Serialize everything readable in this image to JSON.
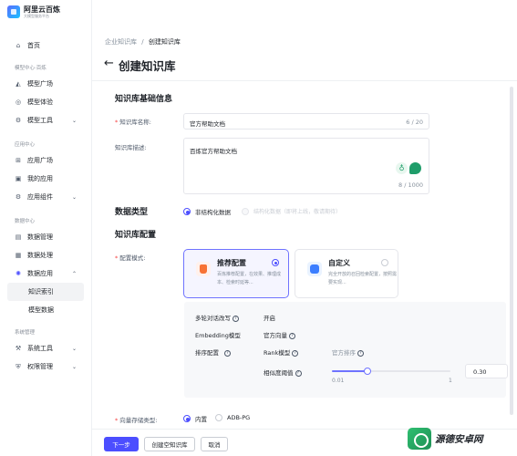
{
  "brand": {
    "title": "阿里云百炼",
    "subtitle": "大模型服务平台"
  },
  "sidebar": {
    "home": "首页",
    "group_model": "模型中心·百炼",
    "model_plaza": "模型广场",
    "model_experience": "模型体验",
    "model_tools": "模型工具",
    "group_app": "应用中心",
    "app_plaza": "应用广场",
    "my_apps": "我的应用",
    "app_components": "应用组件",
    "group_data": "数据中心",
    "data_management": "数据管理",
    "data_processing": "数据处理",
    "data_application": "数据应用",
    "knowledge_index": "知识索引",
    "model_data": "模型数据",
    "group_system": "系统管理",
    "system_tools": "系统工具",
    "permission_management": "权限管理"
  },
  "breadcrumb": {
    "parent": "企业知识库",
    "sep": "/",
    "current": "创建知识库"
  },
  "page": {
    "title": "创建知识库"
  },
  "basic": {
    "section_title": "知识库基础信息",
    "name_label": "知识库名称:",
    "name_value": "官方帮助文档",
    "name_count": "6 / 20",
    "desc_label": "知识库描述:",
    "desc_value": "百炼官方帮助文档",
    "desc_count": "8 / 1000"
  },
  "data_type": {
    "section_title": "数据类型",
    "option_unstructured": "非结构化数据",
    "option_structured": "结构化数据（即将上线，敬请期待）"
  },
  "config": {
    "section_title": "知识库配置",
    "mode_label": "配置模式:",
    "recommended_title": "推荐配置",
    "recommended_desc": "百炼推荐配置，在效果、推理成本、检索时延等...",
    "custom_title": "自定义",
    "custom_desc": "完全开放的召回检索配置，按照需要实现..."
  },
  "panel": {
    "multi_turn_label": "多轮对话改写",
    "multi_turn_value": "开启",
    "embedding_label": "Embedding模型",
    "embedding_value": "官方向量",
    "rank_label": "排序配置",
    "rank_model_label": "Rank模型",
    "rank_model_value": "官方排序",
    "similarity_label": "相似度阈值",
    "similarity_value": "0.30",
    "slider_min": "0.01",
    "slider_max": "1",
    "slider_fraction": 0.3
  },
  "vector_store": {
    "label": "向量存储类型:",
    "option_builtin": "内置",
    "option_adb": "ADB-PG"
  },
  "footer": {
    "next": "下一步",
    "create_empty": "创建空知识库",
    "cancel": "取消"
  },
  "watermark": {
    "text": "源德安卓网"
  },
  "colors": {
    "primary": "#4c4eff",
    "selected_card_border": "#6f73ff",
    "required": "#f53f3f"
  }
}
